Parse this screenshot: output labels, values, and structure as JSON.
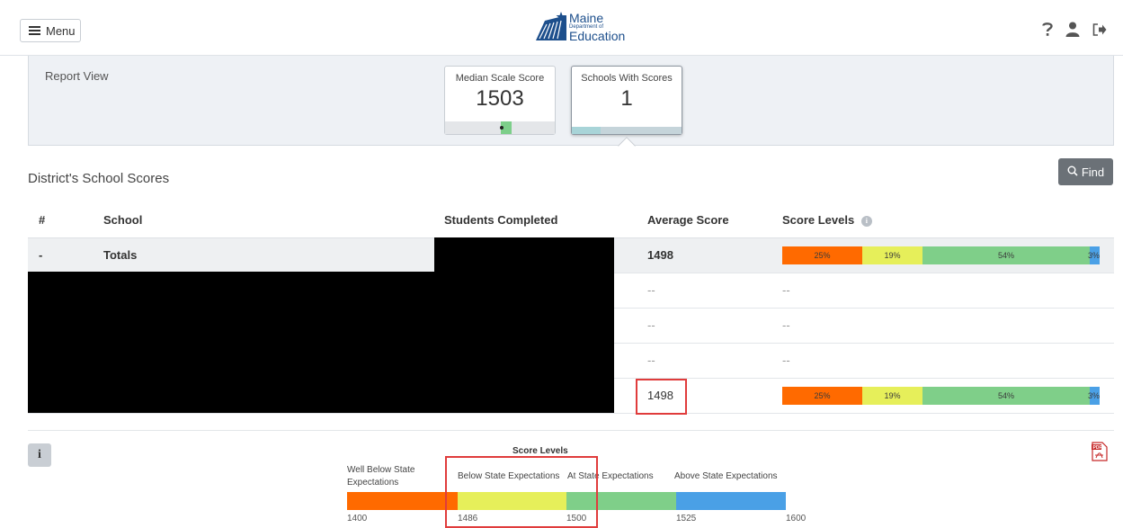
{
  "topbar": {
    "menu_label": "Menu",
    "logo": {
      "line1": "Maine",
      "line2": "Department of",
      "line3": "Education"
    },
    "icons": [
      "help-icon",
      "user-icon",
      "signout-icon"
    ]
  },
  "report": {
    "title": "Report View",
    "kpis": [
      {
        "label": "Median Scale Score",
        "value": "1503"
      },
      {
        "label": "Schools With Scores",
        "value": "1"
      }
    ]
  },
  "section": {
    "title": "District's School Scores",
    "find_label": "Find"
  },
  "table": {
    "headers": [
      "#",
      "School",
      "Students Completed",
      "Average Score",
      "Score Levels"
    ],
    "totals": {
      "num": "-",
      "school": "Totals",
      "avg": "1498"
    },
    "rows": [
      {
        "avg": "--",
        "levels": "--"
      },
      {
        "avg": "--",
        "levels": "--"
      },
      {
        "avg": "--",
        "levels": "--"
      },
      {
        "avg": "1498"
      }
    ],
    "level_pcts": [
      "25%",
      "19%",
      "54%",
      "3%"
    ]
  },
  "legend": {
    "title": "Score Levels",
    "labels": [
      "Well Below State Expectations",
      "Below State Expectations",
      "At State Expectations",
      "Above State Expectations"
    ],
    "ticks": [
      "1400",
      "1486",
      "1500",
      "1525",
      "1600"
    ]
  },
  "colors": {
    "well_below": "#ff6a00",
    "below": "#e6ef5a",
    "at": "#7fcf89",
    "above": "#4aa0e6",
    "highlight": "#e03c3c"
  }
}
